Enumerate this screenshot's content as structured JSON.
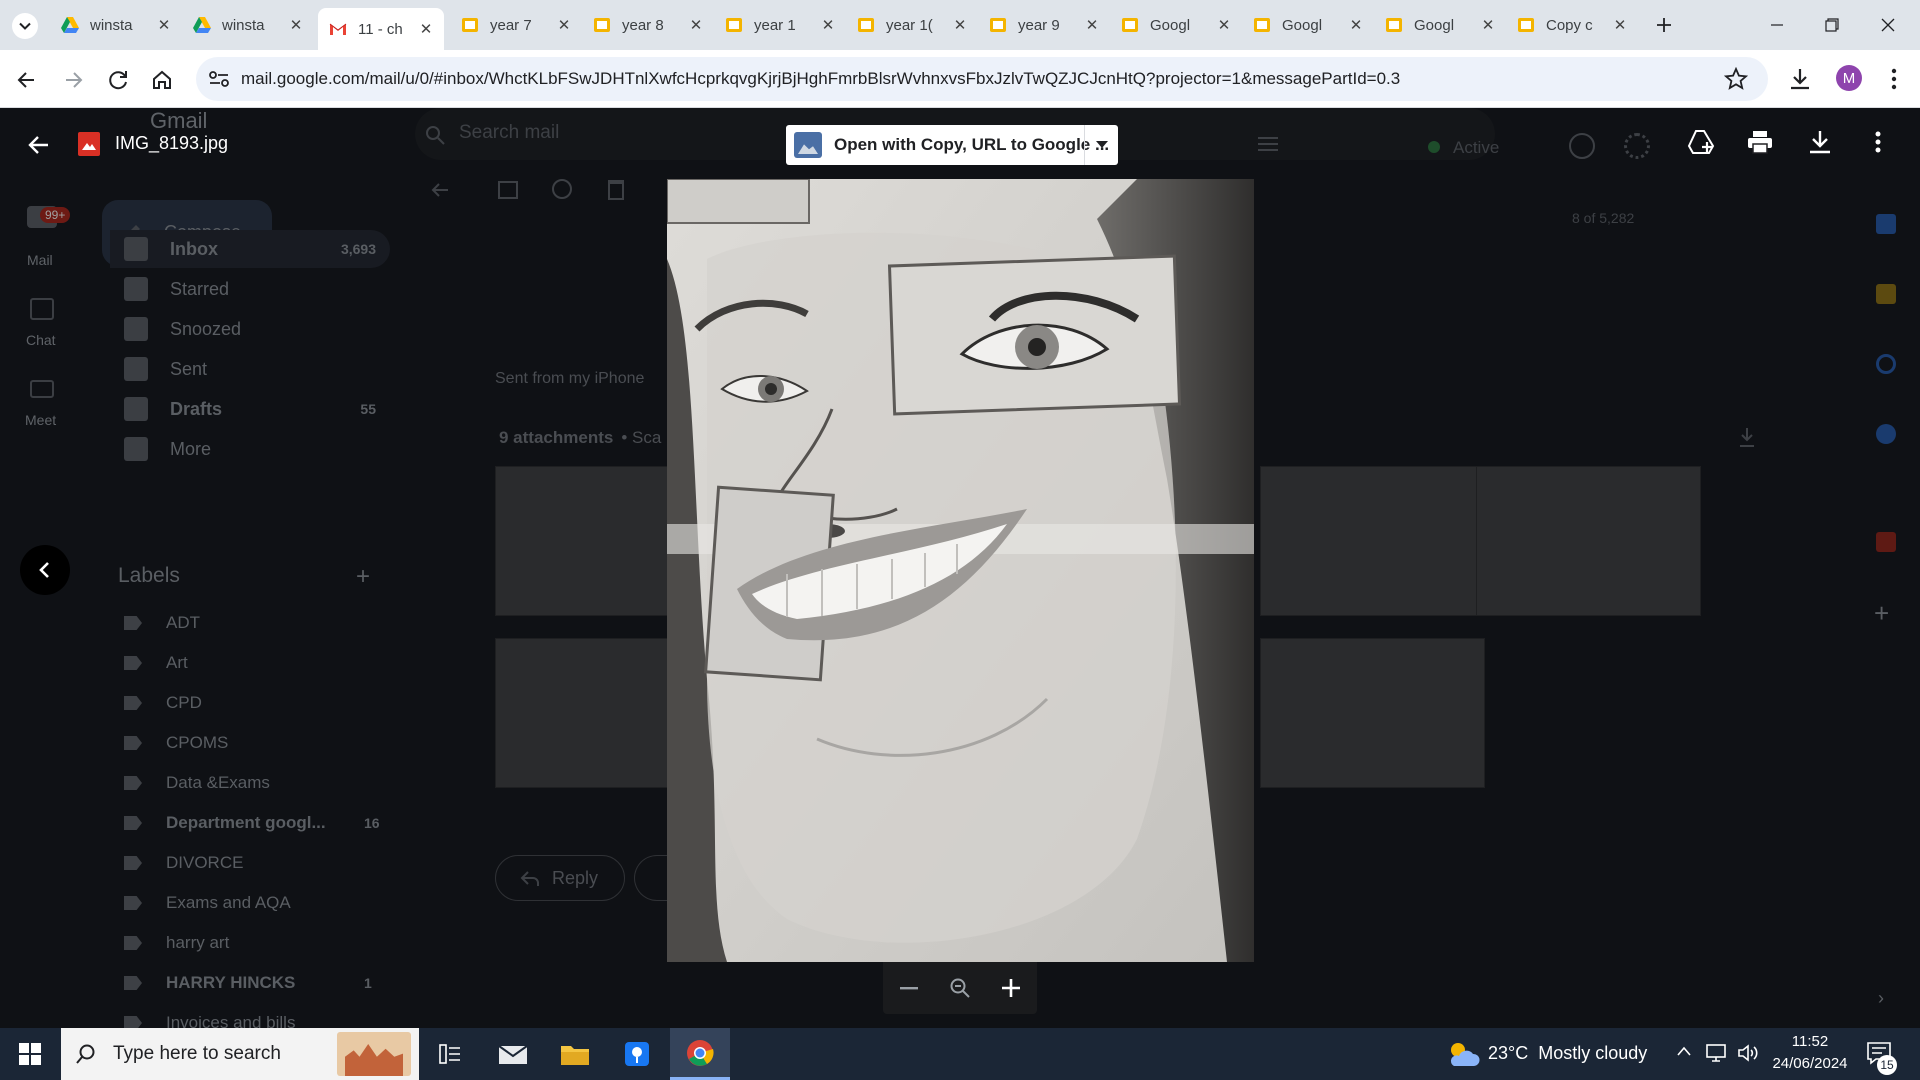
{
  "browser": {
    "tabs": [
      {
        "title": "winsta",
        "icon": "drive-icon"
      },
      {
        "title": "winsta",
        "icon": "drive-icon"
      },
      {
        "title": "11 - ch",
        "icon": "gmail-icon",
        "active": true
      },
      {
        "title": "year 7",
        "icon": "slides-icon"
      },
      {
        "title": "year 8",
        "icon": "slides-icon"
      },
      {
        "title": "year 1",
        "icon": "slides-icon"
      },
      {
        "title": "year 1(",
        "icon": "slides-icon"
      },
      {
        "title": "year 9",
        "icon": "slides-icon"
      },
      {
        "title": "Googl",
        "icon": "slides-icon"
      },
      {
        "title": "Googl",
        "icon": "slides-icon"
      },
      {
        "title": "Googl",
        "icon": "slides-icon"
      },
      {
        "title": "Copy c",
        "icon": "slides-icon"
      }
    ],
    "url": "mail.google.com/mail/u/0/#inbox/WhctKLbFSwJDHTnlXwfcHcprkqvgKjrjBjHghFmrbBlsrWvhnxvsFbxJzlvTwQZJCJcnHtQ?projector=1&messagePartId=0.3",
    "profile_initial": "M"
  },
  "viewer": {
    "file_name": "IMG_8193.jpg",
    "open_with_label": "Open with Copy, URL to Google ...",
    "zoom_out": "−",
    "zoom_in": "+"
  },
  "gmail": {
    "app_name": "Gmail",
    "search_placeholder": "Search mail",
    "status": "Active",
    "rail": [
      {
        "label": "Mail",
        "badge": "99+"
      },
      {
        "label": "Chat"
      },
      {
        "label": "Meet"
      }
    ],
    "compose": "Compose",
    "nav": [
      {
        "label": "Inbox",
        "count": "3,693",
        "bold": true
      },
      {
        "label": "Starred",
        "count": ""
      },
      {
        "label": "Snoozed",
        "count": ""
      },
      {
        "label": "Sent",
        "count": ""
      },
      {
        "label": "Drafts",
        "count": "55",
        "bold": true
      },
      {
        "label": "More",
        "count": ""
      }
    ],
    "labels_heading": "Labels",
    "labels": [
      {
        "label": "ADT",
        "count": ""
      },
      {
        "label": "Art",
        "count": ""
      },
      {
        "label": "CPD",
        "count": ""
      },
      {
        "label": "CPOMS",
        "count": ""
      },
      {
        "label": "Data &Exams",
        "count": ""
      },
      {
        "label": "Department googl...",
        "count": "16",
        "bold": true
      },
      {
        "label": "DIVORCE",
        "count": ""
      },
      {
        "label": "Exams and AQA",
        "count": ""
      },
      {
        "label": "harry art",
        "count": ""
      },
      {
        "label": "HARRY HINCKS",
        "count": "1",
        "bold": true
      },
      {
        "label": "Invoices and bills",
        "count": ""
      }
    ],
    "pagination": "8 of 5,282",
    "sent_from": "Sent from my iPhone",
    "attachments": "9 attachments",
    "attachments_suffix": "• Sca",
    "reply": "Reply"
  },
  "taskbar": {
    "search_placeholder": "Type here to search",
    "weather": "23°C  Mostly cloudy",
    "time": "11:52",
    "date": "24/06/2024",
    "notifications": "15"
  }
}
